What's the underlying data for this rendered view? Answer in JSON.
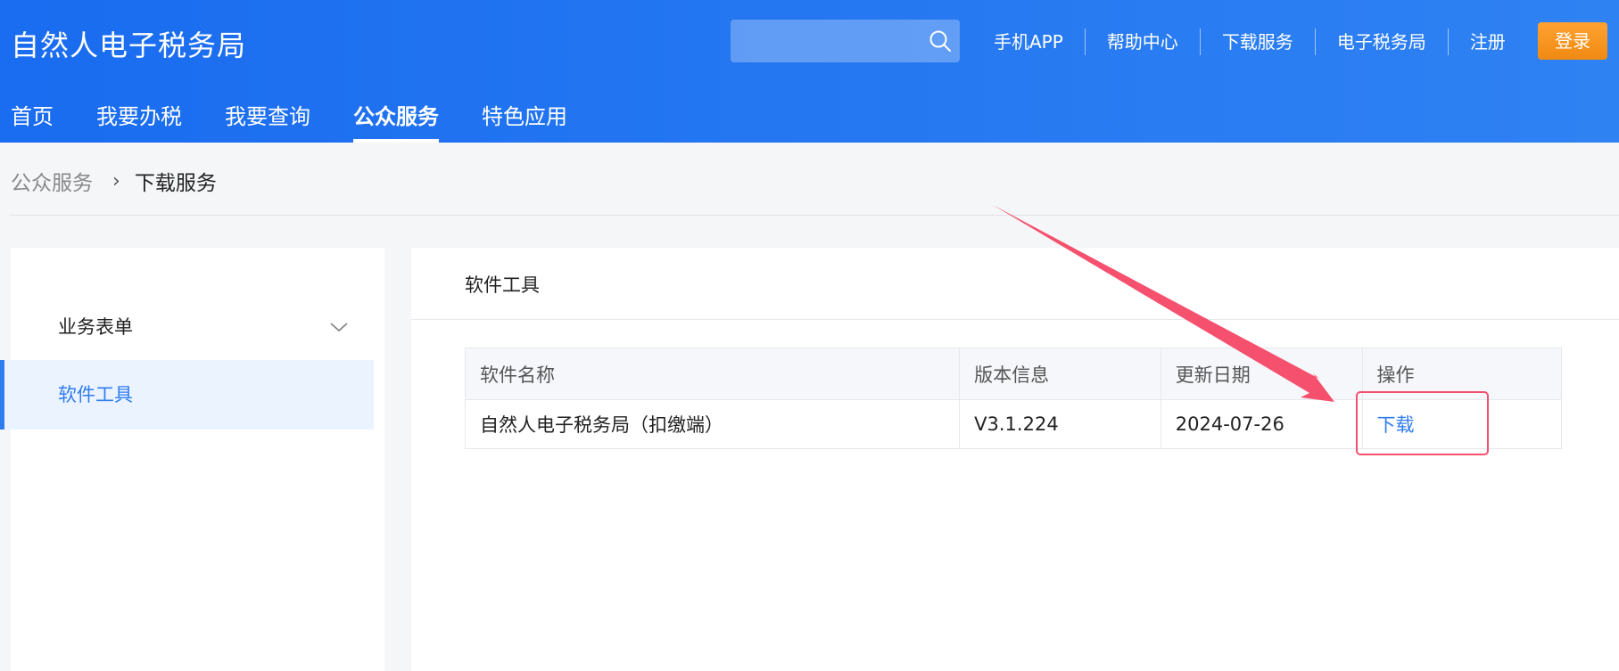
{
  "header": {
    "site_title": "自然人电子税务局",
    "search": {
      "value": "",
      "placeholder": "",
      "icon": "search-icon"
    },
    "top_links": [
      "手机APP",
      "帮助中心",
      "下载服务",
      "电子税务局",
      "注册"
    ],
    "login_label": "登录",
    "nav": [
      {
        "label": "首页",
        "active": false
      },
      {
        "label": "我要办税",
        "active": false
      },
      {
        "label": "我要查询",
        "active": false
      },
      {
        "label": "公众服务",
        "active": true
      },
      {
        "label": "特色应用",
        "active": false
      }
    ]
  },
  "breadcrumb": {
    "parent": "公众服务",
    "current": "下载服务"
  },
  "sidebar": {
    "items": [
      {
        "label": "业务表单",
        "expandable": true,
        "active": false
      },
      {
        "label": "软件工具",
        "expandable": false,
        "active": true
      }
    ]
  },
  "main": {
    "title": "软件工具",
    "table": {
      "headers": [
        "软件名称",
        "版本信息",
        "更新日期",
        "操作"
      ],
      "rows": [
        {
          "name": "自然人电子税务局（扣缴端）",
          "version": "V3.1.224",
          "date": "2024-07-26",
          "action": "下载"
        }
      ]
    }
  },
  "colors": {
    "header_start": "#1a6cf0",
    "header_end": "#2f82f2",
    "login_button": "#f7931e",
    "link_blue": "#2f7cf0",
    "annotation_red": "#f5506e"
  }
}
